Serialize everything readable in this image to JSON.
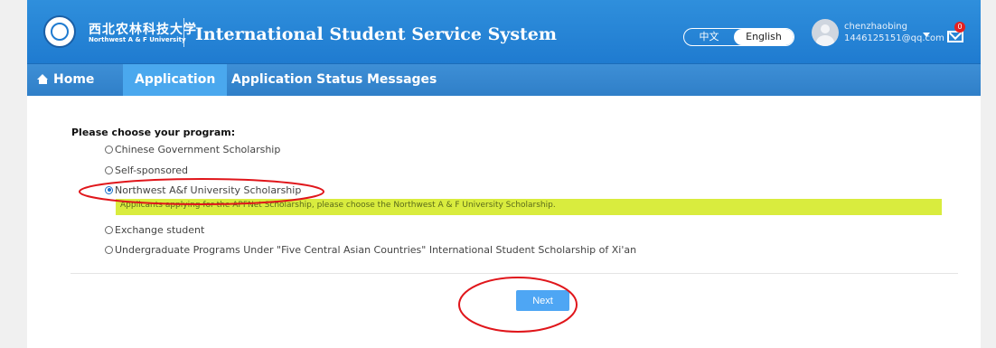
{
  "header": {
    "university_cn": "西北农林科技大学",
    "university_en": "Northwest A & F University",
    "system_title": "International Student Service System",
    "language": {
      "chinese": "中文",
      "english": "English",
      "active": "English"
    },
    "user": {
      "name": "chenzhaobing",
      "email": "1446125151@qq.com"
    },
    "messages_badge": "0"
  },
  "nav": {
    "items": [
      {
        "label": "Home",
        "icon": "home-icon"
      },
      {
        "label": "Application",
        "active": true
      },
      {
        "label": "Application Status"
      },
      {
        "label": "Messages"
      }
    ]
  },
  "form": {
    "prompt": "Please choose your program:",
    "options": [
      {
        "label": "Chinese Government Scholarship",
        "selected": false
      },
      {
        "label": "Self-sponsored",
        "selected": false
      },
      {
        "label": "Northwest A&f University Scholarship",
        "selected": true
      },
      {
        "label": "Exchange student",
        "selected": false
      },
      {
        "label": "Undergraduate Programs Under \"Five Central Asian Countries\" International Student Scholarship of Xi'an",
        "selected": false
      }
    ],
    "hint": "Applicants applying for the APFNet Scholarship, please choose the Northwest A & F University Scholarship.",
    "next_label": "Next"
  },
  "colors": {
    "header_blue": "#1f7bd0",
    "nav_active": "#4aa8ee",
    "hint_highlight": "#d9ec3e",
    "button_blue": "#4ea6f4",
    "annotation_red": "#e0161b"
  }
}
